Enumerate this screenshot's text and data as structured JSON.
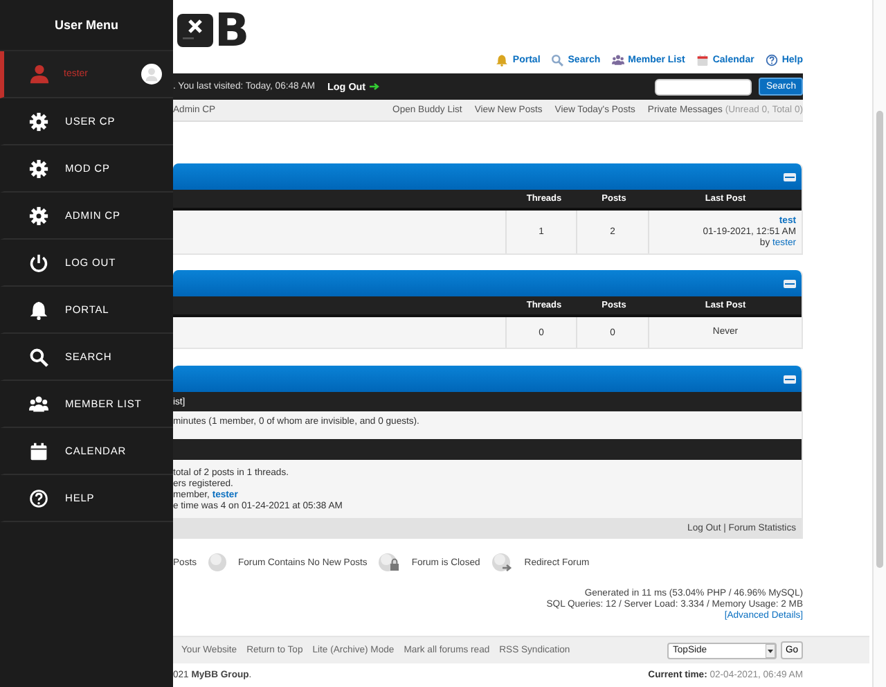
{
  "user_menu": {
    "title": "User Menu",
    "items": [
      {
        "kind": "user",
        "label": "tester",
        "selected": true
      },
      {
        "kind": "gear",
        "label": "USER CP",
        "selected": false
      },
      {
        "kind": "gear",
        "label": "MOD CP",
        "selected": false
      },
      {
        "kind": "gear",
        "label": "ADMIN CP",
        "selected": false
      },
      {
        "kind": "power",
        "label": "LOG OUT",
        "selected": false
      },
      {
        "kind": "bell",
        "label": "PORTAL",
        "selected": false
      },
      {
        "kind": "search",
        "label": "SEARCH",
        "selected": false
      },
      {
        "kind": "group",
        "label": "MEMBER LIST",
        "selected": false
      },
      {
        "kind": "calendar",
        "label": "CALENDAR",
        "selected": false
      },
      {
        "kind": "help",
        "label": "HELP",
        "selected": false
      }
    ]
  },
  "logo": {
    "text": "B"
  },
  "top_links": [
    {
      "kind": "bell",
      "label": "Portal"
    },
    {
      "kind": "search",
      "label": "Search"
    },
    {
      "kind": "group",
      "label": "Member List"
    },
    {
      "kind": "calendar",
      "label": "Calendar"
    },
    {
      "kind": "help",
      "label": "Help"
    }
  ],
  "welcome_bar": {
    "text": ". You last visited: Today, 06:48 AM",
    "logout": "Log Out",
    "search_button": "Search"
  },
  "nav_bar": {
    "left": "Admin CP",
    "links": [
      "Open Buddy List",
      "View New Posts",
      "View Today's Posts"
    ],
    "messages": "Private Messages",
    "messages_count": "(Unread 0, Total 0)"
  },
  "forums": [
    {
      "columns": [
        "Threads",
        "Posts",
        "Last Post"
      ],
      "threads": "1",
      "posts": "2",
      "last_post": {
        "kind": "post",
        "title": "test",
        "date": "01-19-2021, 12:51 AM",
        "by": "by",
        "author": "tester"
      }
    },
    {
      "columns": [
        "Threads",
        "Posts",
        "Last Post"
      ],
      "threads": "0",
      "posts": "0",
      "last_post": {
        "kind": "never",
        "text": "Never"
      }
    }
  ],
  "board_stats": {
    "online_header": "ist]",
    "online_text": "minutes (1 member, 0 of whom are invisible, and 0 guests).",
    "lines": [
      "total of 2 posts in 1 threads.",
      "ers registered.",
      "member, **tester**",
      "e time was 4 on 01-24-2021 at 05:38 AM"
    ],
    "footer": "Log Out | Forum Statistics"
  },
  "legend": [
    {
      "kind": "none",
      "label": "Posts"
    },
    {
      "kind": "off",
      "label": "Forum Contains No New Posts"
    },
    {
      "kind": "closed",
      "label": "Forum is Closed"
    },
    {
      "kind": "redirect",
      "label": "Redirect Forum"
    }
  ],
  "debug": {
    "lines": [
      "Generated in 11 ms (53.04% PHP / 46.96% MySQL)",
      "SQL Queries: 12 / Server Load: 3.334 / Memory Usage: 2 MB"
    ],
    "details": "[Advanced Details]"
  },
  "footer": {
    "links": [
      "Your Website",
      "Return to Top",
      "Lite (Archive) Mode",
      "Mark all forums read",
      "RSS Syndication"
    ],
    "theme_select": "TopSide",
    "go_button": "Go"
  },
  "copyright": "021 **MyBB Group**.",
  "current_time": {
    "label": "Current time:",
    "value": "02-04-2021, 06:49 AM"
  }
}
